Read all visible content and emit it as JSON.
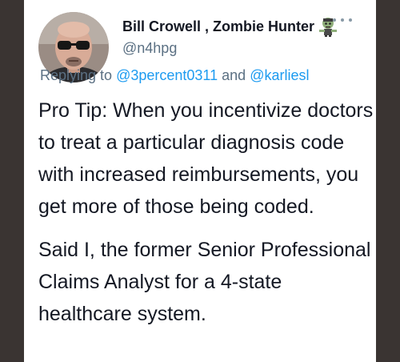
{
  "tweet": {
    "author": {
      "display_name": "Bill Crowell , Zombie Hunter",
      "handle": "@n4hpg",
      "badge_icon": "zombie-icon"
    },
    "more_menu_icon": "ellipsis-icon",
    "replying_to": {
      "prefix": "Replying to",
      "first_mention": "@3percent0311",
      "joiner": "and",
      "second_mention": "@karliesl"
    },
    "paragraphs": [
      "Pro Tip: When you incentivize doctors to treat a particular diagnosis code with increased reimbursements, you get more of those being coded.",
      "Said I, the former Senior Professional Claims Analyst for a 4-state healthcare system."
    ]
  },
  "colors": {
    "background": "#3a3432",
    "text": "#141823",
    "secondary_text": "#5b7083",
    "link": "#1d9bf0"
  }
}
